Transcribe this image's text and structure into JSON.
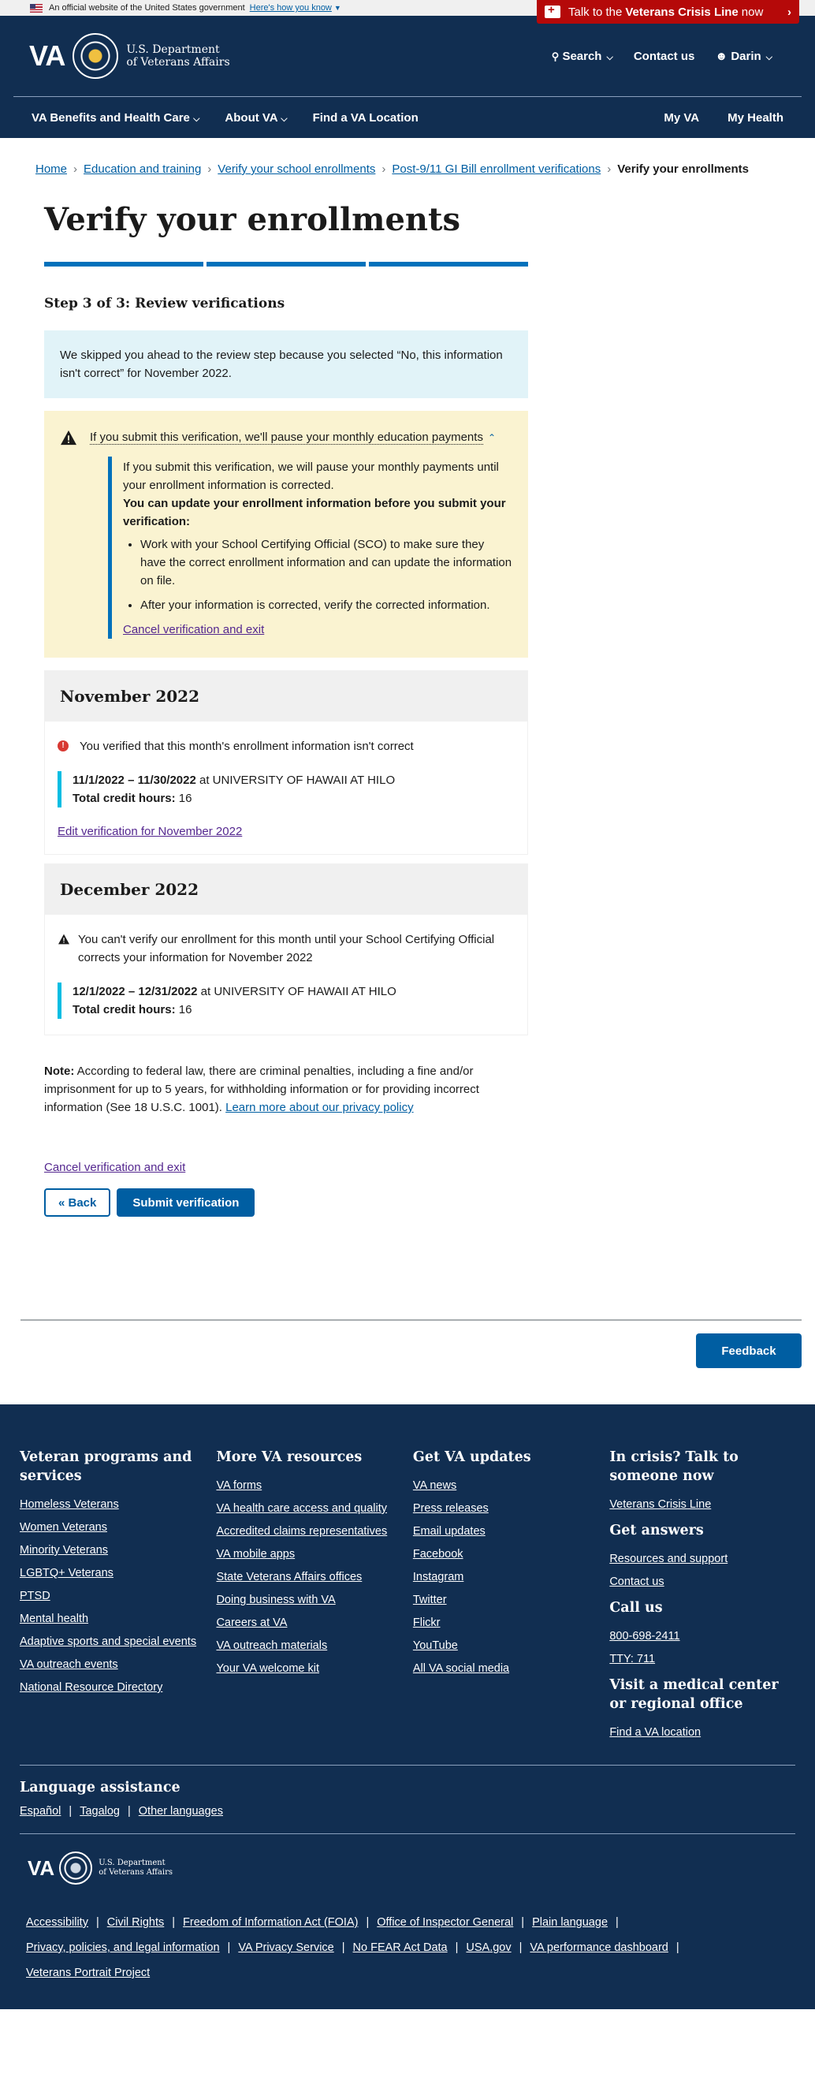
{
  "gov_banner": {
    "text": "An official website of the United States government",
    "howto": "Here's how you know"
  },
  "crisis": {
    "prefix": "Talk to the",
    "bold": "Veterans Crisis Line",
    "suffix": "now"
  },
  "header": {
    "logo": "VA",
    "dept_line1": "U.S. Department",
    "dept_line2": "of Veterans Affairs",
    "search": "Search",
    "contact": "Contact us",
    "user": "Darin"
  },
  "nav": {
    "benefits": "VA Benefits and Health Care",
    "about": "About VA",
    "location": "Find a VA Location",
    "myva": "My VA",
    "myhealth": "My Health"
  },
  "breadcrumb": [
    "Home",
    "Education and training",
    "Verify your school enrollments",
    "Post-9/11 GI Bill enrollment verifications",
    "Verify your enrollments"
  ],
  "page": {
    "title": "Verify your enrollments",
    "step": "Step 3 of 3: Review verifications",
    "info": "We skipped you ahead to the review step because you selected “No, this information isn't correct” for November 2022.",
    "warning": {
      "toggle": "If you submit this verification, we'll pause your monthly education payments",
      "p1": "If you submit this verification, we will pause your monthly payments until your enrollment information is corrected.",
      "p2": "You can update your enrollment information before you submit your verification:",
      "bullets": [
        "Work with your School Certifying Official (SCO) to make sure they have the correct enrollment information and can update the information on file.",
        "After your information is corrected, verify the corrected information."
      ],
      "cancel": "Cancel verification and exit"
    },
    "months": [
      {
        "title": "November 2022",
        "status": "You verified that this month's enrollment information isn't correct",
        "dates": "11/1/2022 – 11/30/2022",
        "school": "at UNIVERSITY OF HAWAII AT HILO",
        "credits_label": "Total credit hours:",
        "credits": "16",
        "edit": "Edit verification for November 2022"
      },
      {
        "title": "December 2022",
        "status": "You can't verify our enrollment for this month until your School Certifying Official corrects your information for November 2022",
        "dates": "12/1/2022 – 12/31/2022",
        "school": "at UNIVERSITY OF HAWAII AT HILO",
        "credits_label": "Total credit hours:",
        "credits": "16"
      }
    ],
    "note_label": "Note:",
    "note": "According to federal law, there are criminal penalties, including a fine and/or imprisonment for up to 5 years, for withholding information or for providing incorrect information (See 18 U.S.C. 1001).",
    "privacy_link": "Learn more about our privacy policy",
    "cancel": "Cancel verification and exit",
    "back": "« Back",
    "submit": "Submit verification"
  },
  "feedback": "Feedback",
  "footer": {
    "col1": {
      "title": "Veteran programs and services",
      "links": [
        "Homeless Veterans",
        "Women Veterans",
        "Minority Veterans",
        "LGBTQ+ Veterans",
        "PTSD",
        "Mental health",
        "Adaptive sports and special events",
        "VA outreach events",
        "National Resource Directory"
      ]
    },
    "col2": {
      "title": "More VA resources",
      "links": [
        "VA forms",
        "VA health care access and quality",
        "Accredited claims representatives",
        "VA mobile apps",
        "State Veterans Affairs offices",
        "Doing business with VA",
        "Careers at VA",
        "VA outreach materials",
        "Your VA welcome kit"
      ]
    },
    "col3": {
      "title": "Get VA updates",
      "links": [
        "VA news",
        "Press releases",
        "Email updates",
        "Facebook",
        "Instagram",
        "Twitter",
        "Flickr",
        "YouTube",
        "All VA social media"
      ]
    },
    "col4": {
      "crisis_title": "In crisis? Talk to someone now",
      "crisis_link": "Veterans Crisis Line",
      "answers_title": "Get answers",
      "answers_links": [
        "Resources and support",
        "Contact us"
      ],
      "call_title": "Call us",
      "phone": "800-698-2411",
      "tty": "TTY: 711",
      "visit_title": "Visit a medical center or regional office",
      "visit_link": "Find a VA location"
    },
    "language": {
      "title": "Language assistance",
      "links": [
        "Español",
        "Tagalog",
        "Other languages"
      ]
    },
    "logo": "VA",
    "dept_line1": "U.S. Department",
    "dept_line2": "of Veterans Affairs",
    "bottom_links": [
      "Accessibility",
      "Civil Rights",
      "Freedom of Information Act (FOIA)",
      "Office of Inspector General",
      "Plain language",
      "Privacy, policies, and legal information",
      "VA Privacy Service",
      "No FEAR Act Data",
      "USA.gov",
      "VA performance dashboard",
      "Veterans Portrait Project"
    ]
  }
}
